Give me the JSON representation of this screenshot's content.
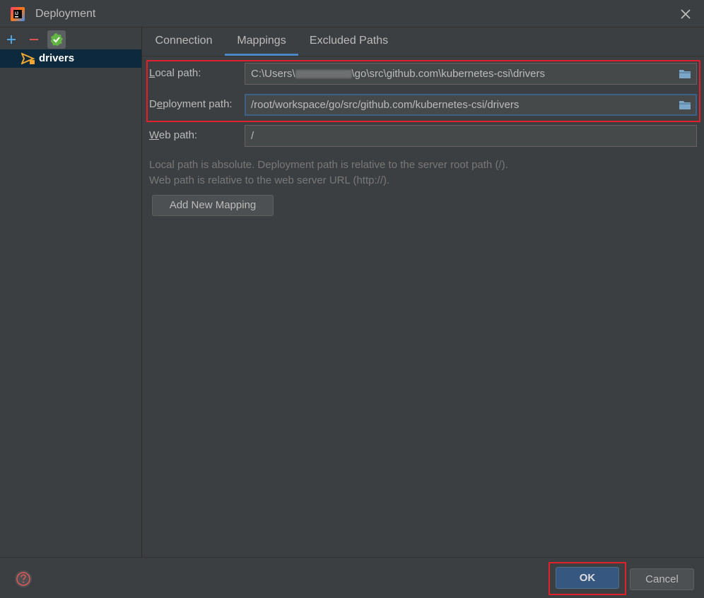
{
  "window": {
    "title": "Deployment"
  },
  "toolbar": {
    "add_icon": "plus-icon",
    "remove_icon": "minus-icon",
    "check_icon": "check-badge-icon"
  },
  "tree": {
    "items": [
      {
        "label": "drivers",
        "icon": "server-upload-icon"
      }
    ]
  },
  "tabs": [
    {
      "label": "Connection"
    },
    {
      "label": "Mappings",
      "selected": true
    },
    {
      "label": "Excluded Paths"
    }
  ],
  "mappings": {
    "local_path": {
      "mnemonic": "L",
      "rest": "ocal path:",
      "value_prefix": "C:\\Users\\",
      "value_suffix": "\\go\\src\\github.com\\kubernetes-csi\\drivers"
    },
    "deployment_path": {
      "pre": "D",
      "mnemonic": "e",
      "rest": "ployment path:",
      "value": "/root/workspace/go/src/github.com/kubernetes-csi/drivers"
    },
    "web_path": {
      "mnemonic": "W",
      "rest": "eb path:",
      "value": "/"
    },
    "hint_line1": "Local path is absolute. Deployment path is relative to the server root path (/).",
    "hint_line2": "Web path is relative to the web server URL (http://).",
    "add_button": "Add New Mapping"
  },
  "footer": {
    "ok": "OK",
    "cancel": "Cancel",
    "help_icon": "help-icon"
  },
  "colors": {
    "accent": "#4a88c7",
    "highlight": "#e0202a",
    "ok_button": "#365880"
  }
}
